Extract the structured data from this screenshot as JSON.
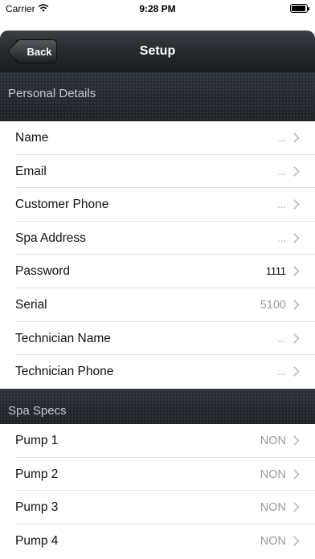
{
  "status_bar": {
    "carrier": "Carrier",
    "time": "9:28 PM"
  },
  "nav": {
    "back_label": "Back",
    "title": "Setup"
  },
  "sections": [
    {
      "title": "Personal Details",
      "rows": [
        {
          "label": "Name",
          "value": "..."
        },
        {
          "label": "Email",
          "value": "..."
        },
        {
          "label": "Customer Phone",
          "value": "..."
        },
        {
          "label": "Spa Address",
          "value": "..."
        },
        {
          "label": "Password",
          "value": "1111"
        },
        {
          "label": "Serial",
          "value": "5100"
        },
        {
          "label": "Technician Name",
          "value": "..."
        },
        {
          "label": "Technician Phone",
          "value": "..."
        }
      ]
    },
    {
      "title": "Spa Specs",
      "rows": [
        {
          "label": "Pump 1",
          "value": "NON"
        },
        {
          "label": "Pump 2",
          "value": "NON"
        },
        {
          "label": "Pump 3",
          "value": "NON"
        },
        {
          "label": "Pump 4",
          "value": "NON"
        }
      ]
    }
  ],
  "icons": {
    "wifi": "wifi-icon",
    "battery": "battery-icon",
    "chevron": "chevron-right-icon",
    "back": "back-arrow-icon"
  }
}
